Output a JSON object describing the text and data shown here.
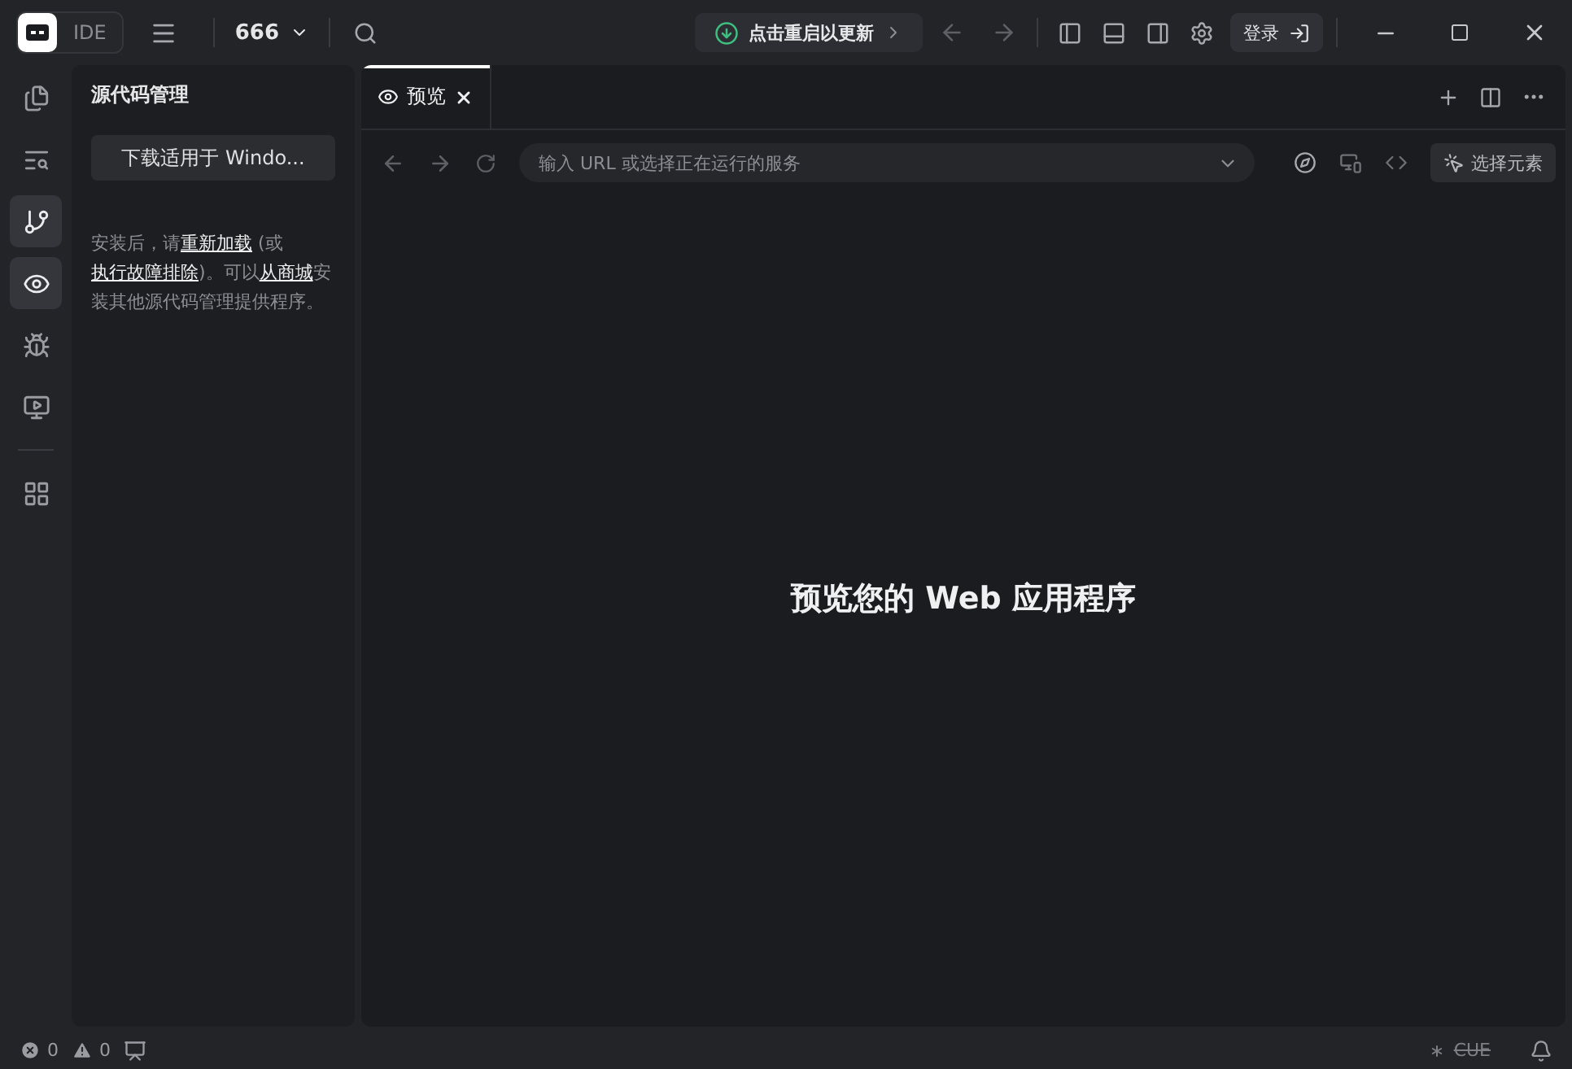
{
  "titlebar": {
    "logo_label": "IDE",
    "project": "666",
    "update_button": "点击重启以更新",
    "login_button": "登录"
  },
  "activity_bar": [
    {
      "selected": false
    },
    {
      "selected": false
    },
    {
      "selected": true
    },
    {
      "selected": true
    },
    {
      "selected": false
    },
    {
      "selected": false
    },
    {
      "selected": false
    }
  ],
  "sidebar": {
    "title": "源代码管理",
    "download_button": "下载适用于 Windo...",
    "description": [
      {
        "kind": "text",
        "text": "安装后，请"
      },
      {
        "kind": "link",
        "text": "重新加载"
      },
      {
        "kind": "text",
        "text": " (或"
      },
      {
        "kind": "link",
        "text": "执行故障排除"
      },
      {
        "kind": "text",
        "text": ")。可以"
      },
      {
        "kind": "link",
        "text": "从商城"
      },
      {
        "kind": "text",
        "text": "安装其他源代码管理提供程序。"
      }
    ]
  },
  "tabs": [
    {
      "label": "预览",
      "selected": true
    }
  ],
  "url_bar": {
    "placeholder": "输入 URL 或选择正在运行的服务",
    "select_element_button": "选择元素"
  },
  "preview": {
    "message": "预览您的 Web 应用程序"
  },
  "status_bar": {
    "errors": "0",
    "warnings": "0",
    "right_label": "CUE"
  }
}
